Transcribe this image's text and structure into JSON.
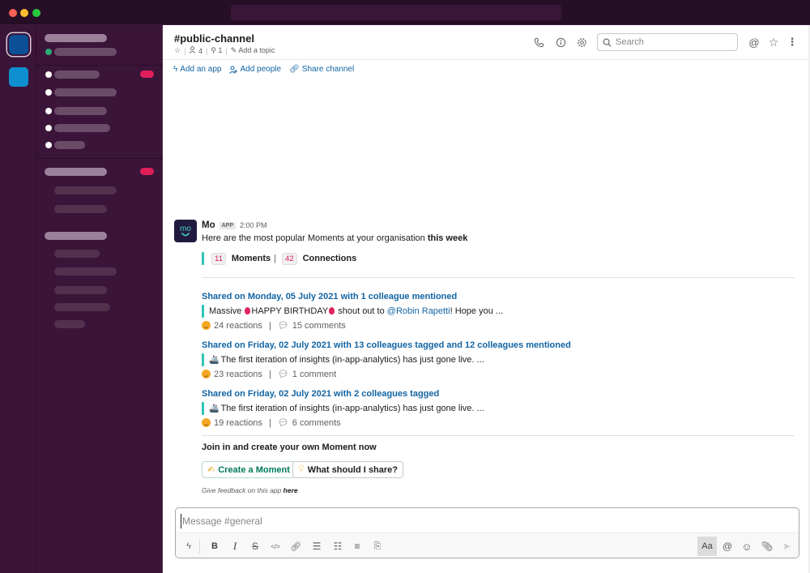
{
  "window": {
    "controls": [
      "close",
      "minimize",
      "maximize"
    ]
  },
  "workspaces": [
    {
      "name": "workspace-1",
      "color": "#0b4f96",
      "active": true
    },
    {
      "name": "workspace-2",
      "color": "#0e8fd0",
      "active": false
    }
  ],
  "channel": {
    "title": "#public-channel",
    "members_count": "4",
    "pinned_count": "1",
    "add_topic": "Add a topic"
  },
  "header_icons": [
    "phone-icon",
    "info-icon",
    "gear-icon"
  ],
  "search": {
    "placeholder": "Search"
  },
  "header_right_icons": [
    "at-icon",
    "star-icon",
    "more-icon"
  ],
  "actions": {
    "add_app": "Add an app",
    "add_people": "Add people",
    "share_channel": "Share channel"
  },
  "message": {
    "sender": "Mo",
    "badge": "APP",
    "time": "2:00 PM",
    "avatar_text": "mo",
    "intro": "Here are the most popular Moments at your organisation ",
    "intro_bold": "this week",
    "stats": {
      "moments_count": "11",
      "moments_label": "Moments",
      "connections_count": "42",
      "connections_label": "Connections"
    },
    "moments": [
      {
        "title": "Shared on Monday, 05 July 2021 with 1 colleague mentioned",
        "text_before": "Massive ",
        "text_mid": "HAPPY BIRTHDAY",
        "text_after": " shout out to ",
        "mention": "@Robin Rapetti",
        "text_end": "! Hope you ...",
        "reactions": "24 reactions",
        "comments": "15 comments"
      },
      {
        "title": "Shared on Friday, 02 July 2021 with 13 colleagues tagged and 12 colleagues mentioned",
        "text": "The first iteration of insights (in-app-analytics) has just gone live. ...",
        "reactions": "23 reactions",
        "comments": "1 comment"
      },
      {
        "title": "Shared on Friday, 02 July 2021 with 2 colleagues tagged",
        "text": "The first iteration of insights (in-app-analytics) has just gone live. ...",
        "reactions": "19 reactions",
        "comments": "6 comments"
      }
    ],
    "cta_title": "Join in and create your own Moment now",
    "btn_create": "Create a Moment",
    "btn_share": "What should I share?",
    "feedback_text": "Give feedback on this app ",
    "feedback_link": "here"
  },
  "composer": {
    "placeholder": "Message #general",
    "aa_label": "Aa"
  },
  "sidebar_badges": {
    "color": "#e01e5a"
  }
}
